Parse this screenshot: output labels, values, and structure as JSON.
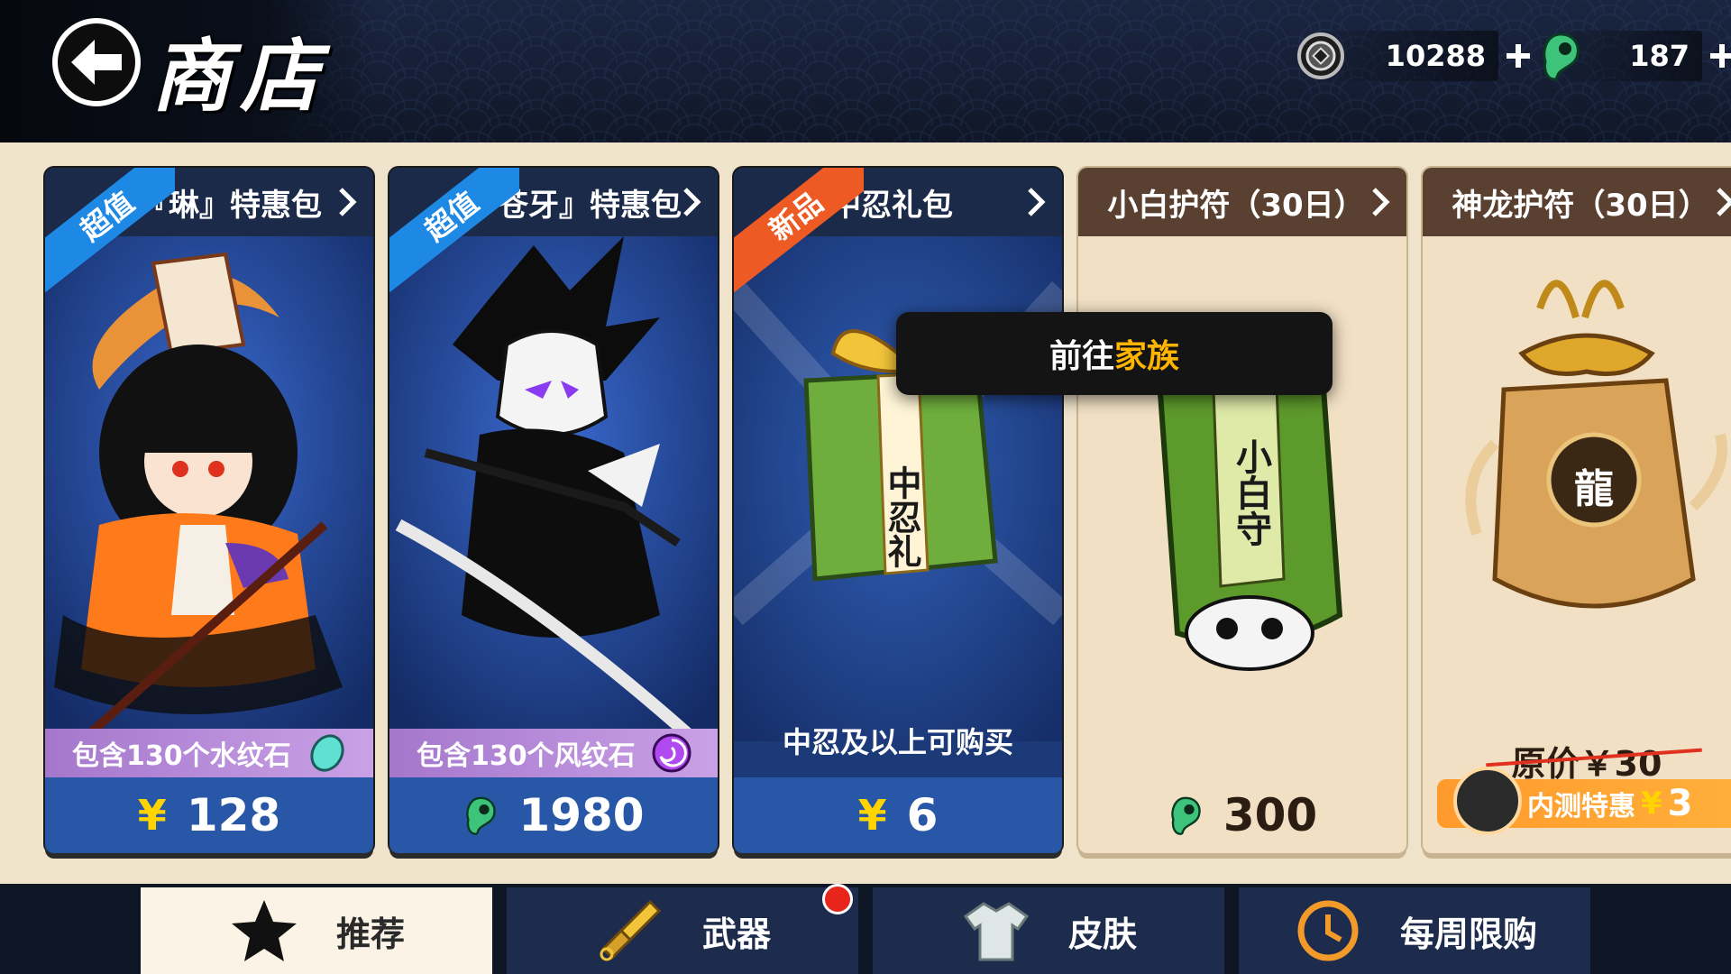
{
  "header": {
    "title": "商店",
    "coins": "10288",
    "jade": "187"
  },
  "tooltip": {
    "prefix": "前往",
    "highlight": "家族"
  },
  "cards": [
    {
      "ribbon": "超值",
      "title": "『琳』特惠包",
      "info": "包含130个水纹石",
      "price": "128",
      "currency": "yen"
    },
    {
      "ribbon": "超值",
      "title": "『苍牙』特惠包",
      "info": "包含130个风纹石",
      "price": "1980",
      "currency": "jade"
    },
    {
      "ribbon": "新品",
      "title": "中忍礼包",
      "gift_text": "中忍礼",
      "note": "中忍及以上可购买",
      "price": "6",
      "currency": "yen"
    },
    {
      "title": "小白护符（30日）",
      "charm_text": "小白守",
      "price": "300",
      "currency": "jade"
    },
    {
      "title": "神龙护符（30日）",
      "charm_text": "龍",
      "original_price": "原价￥30",
      "promo_label": "内测特惠",
      "promo_price": "3",
      "currency": "yen"
    }
  ],
  "yen_symbol": "¥",
  "tabs": [
    {
      "label": "推荐",
      "active": true
    },
    {
      "label": "武器",
      "active": false
    },
    {
      "label": "皮肤",
      "active": false
    },
    {
      "label": "每周限购",
      "active": false
    }
  ],
  "colors": {
    "accent_gold": "#ffd400",
    "tooltip_highlight": "#ffb400",
    "ribbon_blue": "#1e88e5",
    "ribbon_red": "#ee5a24"
  }
}
